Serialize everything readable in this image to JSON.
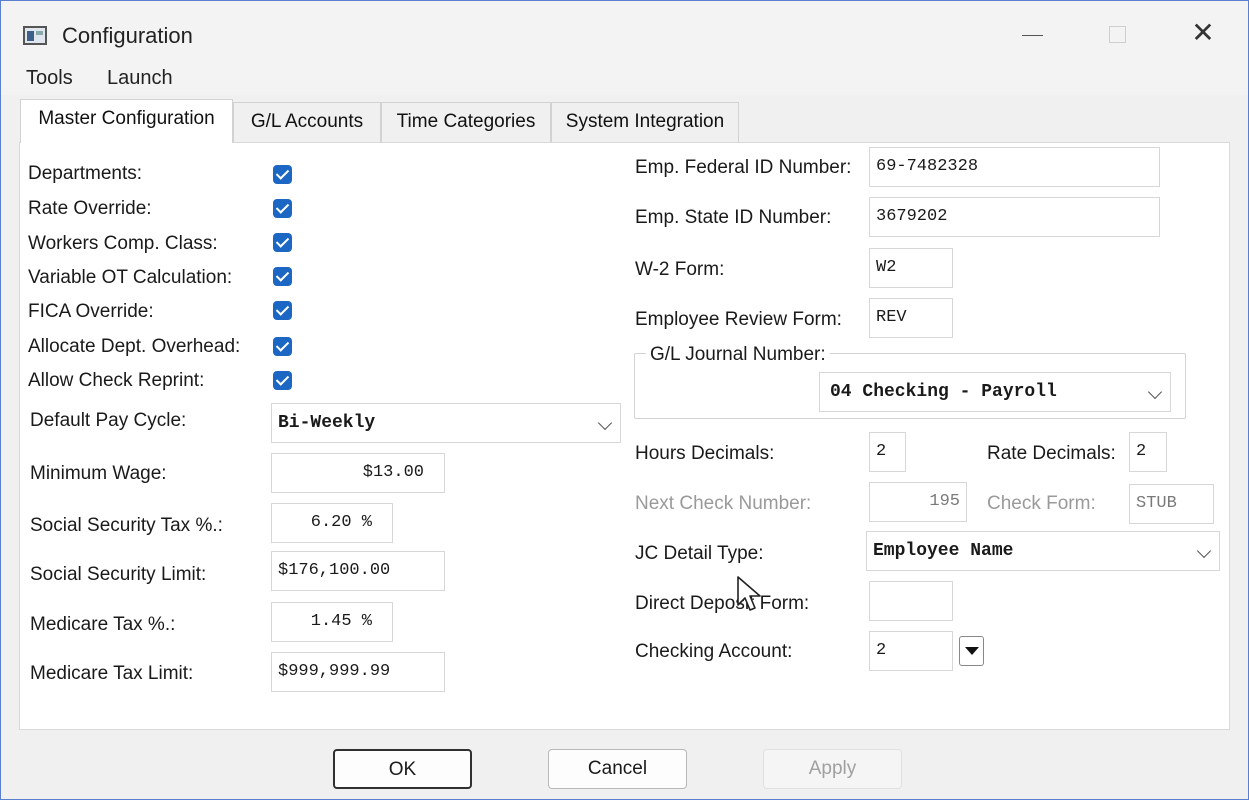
{
  "window": {
    "title": "Configuration"
  },
  "menu": {
    "tools": "Tools",
    "launch": "Launch"
  },
  "tabs": [
    "Master Configuration",
    "G/L Accounts",
    "Time Categories",
    "System Integration"
  ],
  "checkboxes": [
    {
      "label": "Departments:",
      "checked": true
    },
    {
      "label": "Rate Override:",
      "checked": true
    },
    {
      "label": "Workers Comp. Class:",
      "checked": true
    },
    {
      "label": "Variable OT Calculation:",
      "checked": true
    },
    {
      "label": "FICA Override:",
      "checked": true
    },
    {
      "label": "Allocate Dept. Overhead:",
      "checked": true
    },
    {
      "label": "Allow Check Reprint:",
      "checked": true
    }
  ],
  "left_fields": {
    "default_pay_cycle": {
      "label": "Default Pay Cycle:",
      "value": "Bi-Weekly"
    },
    "minimum_wage": {
      "label": "Minimum Wage:",
      "value": "$13.00"
    },
    "social_security_tax": {
      "label": "Social Security Tax %.:",
      "value": "6.20 %"
    },
    "social_security_limit": {
      "label": "Social Security Limit:",
      "value": "$176,100.00"
    },
    "medicare_tax": {
      "label": "Medicare Tax %.:",
      "value": "1.45 %"
    },
    "medicare_tax_limit": {
      "label": "Medicare Tax Limit:",
      "value": "$999,999.99"
    }
  },
  "right_fields": {
    "federal_id": {
      "label": "Emp. Federal ID Number:",
      "value": "69-7482328"
    },
    "state_id": {
      "label": "Emp. State ID Number:",
      "value": "3679202"
    },
    "w2_form": {
      "label": "W-2 Form:",
      "value": "W2"
    },
    "review_form": {
      "label": "Employee Review Form:",
      "value": "REV"
    },
    "gl_journal": {
      "label": "G/L Journal Number:",
      "value": "04 Checking - Payroll"
    },
    "hours_decimals": {
      "label": "Hours Decimals:",
      "value": "2"
    },
    "rate_decimals": {
      "label": "Rate Decimals:",
      "value": "2"
    },
    "next_check_number": {
      "label": "Next Check Number:",
      "value": "195"
    },
    "check_form": {
      "label": "Check Form:",
      "value": "STUB"
    },
    "jc_detail_type": {
      "label": "JC Detail Type:",
      "value": "Employee Name"
    },
    "direct_deposit_form": {
      "label": "Direct Deposit Form:",
      "value": ""
    },
    "checking_account": {
      "label": "Checking Account:",
      "value": "2"
    }
  },
  "buttons": {
    "ok": "OK",
    "cancel": "Cancel",
    "apply": "Apply"
  },
  "colors": {
    "accent": "#1d67c4",
    "border": "#5a7fd1"
  }
}
